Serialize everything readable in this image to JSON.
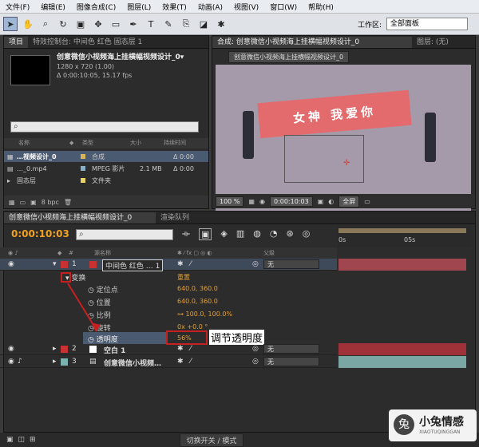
{
  "menu": [
    "文件(F)",
    "编辑(E)",
    "图像合成(C)",
    "图层(L)",
    "效果(T)",
    "动画(A)",
    "视图(V)",
    "窗口(W)",
    "帮助(H)"
  ],
  "workspace": {
    "label": "工作区:",
    "value": "全部面板"
  },
  "project_panel": {
    "tab1": "项目",
    "tab2": "特效控制台: 中间色 红色 固态层 1",
    "comp_name": "创意微信小视频海上挂横幅视频设计_0▾",
    "comp_res": "1280 x 720 (1.00)",
    "comp_dur": "Δ 0:00:10:05, 15.17 fps",
    "col_name": "名称",
    "col_type": "类型",
    "col_size": "大小",
    "col_dur": "持续时间",
    "items": [
      {
        "name": "…视频设计_0",
        "type": "合成",
        "size": "",
        "dur": "Δ 0:00",
        "color": "#d8b45a"
      },
      {
        "name": "…_0.mp4",
        "type": "MPEG 影片",
        "size": "2.1 MB",
        "dur": "Δ 0:00",
        "color": "#8ab0c8"
      },
      {
        "name": "固态层",
        "type": "文件夹",
        "size": "",
        "dur": "",
        "color": "#e8d36a"
      }
    ],
    "bpc": "8 bpc"
  },
  "viewer": {
    "tab": "合成: 创意微信小视频海上挂横幅视频设计_0",
    "tab_right": "图层: (无)",
    "comp_button": "创意微信小视频海上挂横幅视频设计_0",
    "banner_text": "女神  我爱你",
    "zoom": "100 %",
    "time": "0:00:10:03",
    "res": "全屏"
  },
  "timeline": {
    "tab": "创意微信小视频海上挂横幅视频设计_0",
    "tab2": "渲染队列",
    "current_time": "0:00:10:03",
    "col_source": "源名称",
    "col_parent": "父级",
    "ruler": [
      "0s",
      "05s"
    ],
    "layers": [
      {
        "num": "1",
        "name": "中间色 红色 … 1",
        "color": "#c83232",
        "parent": "无"
      },
      {
        "num": "2",
        "name": "空白 1",
        "color": "#c83232",
        "parent": "无"
      },
      {
        "num": "3",
        "name": "创意微信小视频…",
        "color": "#7ab3b0",
        "parent": "无"
      }
    ],
    "transform": {
      "label": "变换",
      "reset": "重置",
      "props": [
        {
          "name": "定位点",
          "value": "640.0, 360.0"
        },
        {
          "name": "位置",
          "value": "640.0, 360.0"
        },
        {
          "name": "比例",
          "value": "100.0, 100.0%"
        },
        {
          "name": "旋转",
          "value": "0x +0.0 °"
        },
        {
          "name": "透明度",
          "value": "56%"
        }
      ]
    },
    "annotation": "调节透明度",
    "status": "切换开关 / 模式"
  },
  "watermark": {
    "title": "小兔情感",
    "sub": "XIAOTUQINGGAN"
  }
}
